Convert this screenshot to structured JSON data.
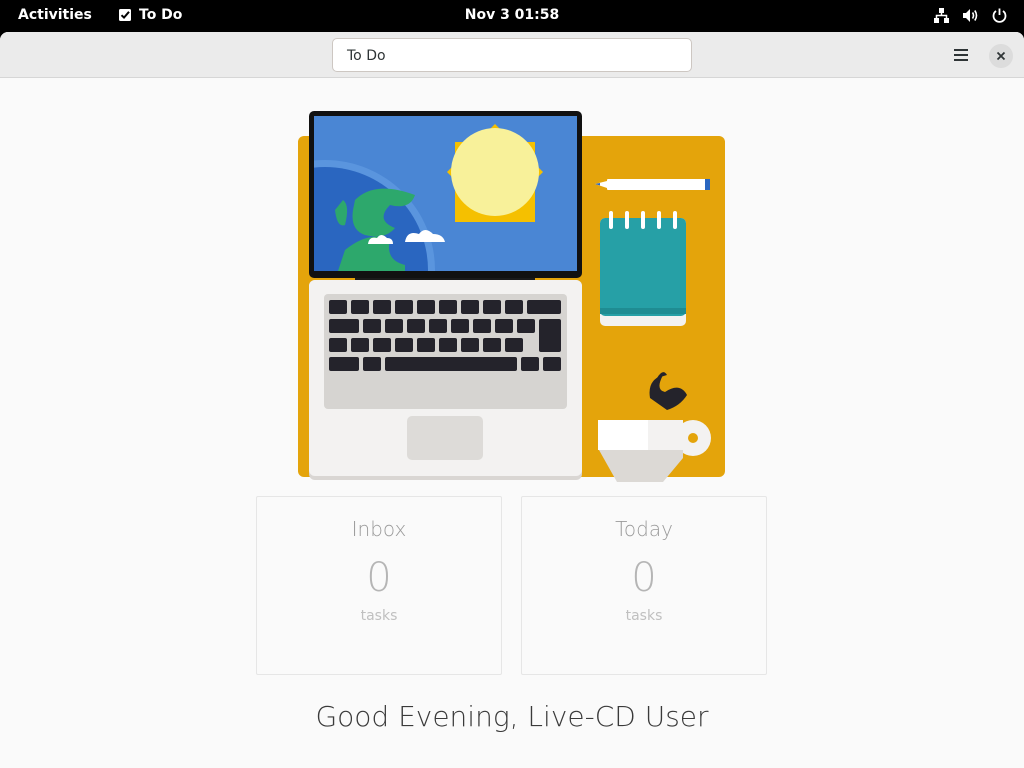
{
  "topbar": {
    "activities_label": "Activities",
    "app_name": "To Do",
    "clock": "Nov 3  01:58",
    "tray_icons": [
      "network-icon",
      "volume-icon",
      "power-icon"
    ]
  },
  "headerbar": {
    "title": "To Do"
  },
  "cards": [
    {
      "title": "Inbox",
      "count": "0",
      "unit": "tasks"
    },
    {
      "title": "Today",
      "count": "0",
      "unit": "tasks"
    }
  ],
  "greeting": "Good Evening, Live-CD User",
  "colors": {
    "desk": "#e4a40b",
    "screen": "#4a86d4",
    "sun": "#f8f19a",
    "notepad": "#26a0a6"
  }
}
